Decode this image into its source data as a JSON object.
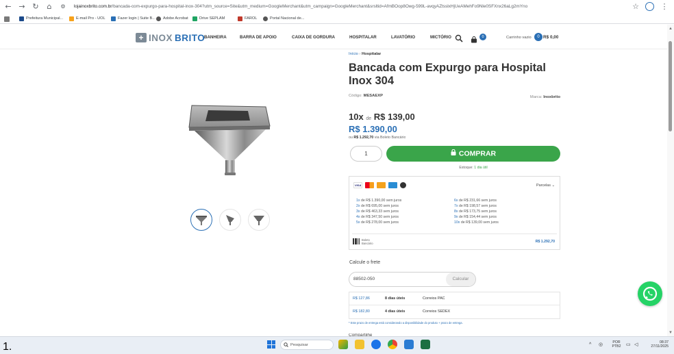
{
  "browser": {
    "url_host": "lojainoxbrito.com.br",
    "url_rest": "/bancada-com-expurgo-para-hospital-inox-304?utm_source=Site&utm_medium=GoogleMerchant&utm_campaign=GoogleMerchant&srsltid=AfmBOop8Owg-599L-avqyAZtsslxHjUeAMehFo9Nle0SFXnx26aLg2mYno",
    "bookmarks": [
      "Prefeitura Municipal...",
      "E-mail Pro - UOL",
      "Fazer login | Suite B...",
      "Adobe Acrobat",
      "Drive SEPLAM",
      "FAROL",
      "Portal Nacional de..."
    ],
    "colors": {
      "accent": "#2a6fb5"
    }
  },
  "site": {
    "logo_part1": "INOX",
    "logo_part2": "BRITO",
    "menu": [
      "BANHEIRA",
      "BARRA DE APOIO",
      "CAIXA DE GORDURA",
      "HOSPITALAR",
      "LAVATÓRIO",
      "MICTÓRIO"
    ],
    "wishlist_count": "0",
    "cart_label": "Carrinho vazio",
    "cart_count": "0",
    "cart_total": "R$ 0,00"
  },
  "product": {
    "breadcrumb_home": "Início",
    "breadcrumb_sep": "›",
    "breadcrumb_current": "Hospitalar",
    "title": "Bancada com Expurgo para Hospital Inox 304",
    "code_label": "Código:",
    "code": "MESAEXP",
    "brand_label": "Marca:",
    "brand": "Inoxbrito",
    "installments": "10x",
    "installments_de": "de",
    "installment_value": "R$ 139,00",
    "price": "R$ 1.390,00",
    "boleto_prefix": "ou",
    "boleto_price": "R$ 1.292,70",
    "boleto_suffix": "via Boleto Bancário",
    "quantity": "1",
    "buy_label": "COMPRAR",
    "stock_label": "Estoque:",
    "stock_value": "1 dia útil"
  },
  "payment": {
    "parcelas_label": "Parcelas",
    "left": [
      {
        "n": "1x",
        "text": "de R$ 1.390,00 sem juros"
      },
      {
        "n": "2x",
        "text": "de R$ 695,00 sem juros"
      },
      {
        "n": "3x",
        "text": "de R$ 463,33 sem juros"
      },
      {
        "n": "4x",
        "text": "de R$ 347,50 sem juros"
      },
      {
        "n": "5x",
        "text": "de R$ 278,00 sem juros"
      }
    ],
    "right": [
      {
        "n": "6x",
        "text": "de R$ 231,66 sem juros"
      },
      {
        "n": "7x",
        "text": "de R$ 198,57 sem juros"
      },
      {
        "n": "8x",
        "text": "de R$ 173,75 sem juros"
      },
      {
        "n": "9x",
        "text": "de R$ 154,44 sem juros"
      },
      {
        "n": "10x",
        "text": "de R$ 139,00 sem juros"
      }
    ],
    "boleto_label": "Boleto Bancário",
    "boleto_value": "R$ 1.292,70"
  },
  "shipping": {
    "title": "Calcule o frete",
    "cep": "88502-050",
    "calc_label": "Calcular",
    "options": [
      {
        "price": "R$ 127,86",
        "days": "8 dias úteis",
        "carrier": "Correios PAC"
      },
      {
        "price": "R$ 182,80",
        "days": "4 dias úteis",
        "carrier": "Correios SEDEX"
      }
    ],
    "note": "* Este prazo de entrega está considerando a disponibilidade do produto + prazo de entrega.",
    "next_section": "Compartilhe"
  },
  "taskbar": {
    "list_marker": "1.",
    "search_placeholder": "Pesquisar",
    "lang_top": "POR",
    "lang_bottom": "PTB2",
    "time": "08:37",
    "date": "27/11/2025"
  }
}
